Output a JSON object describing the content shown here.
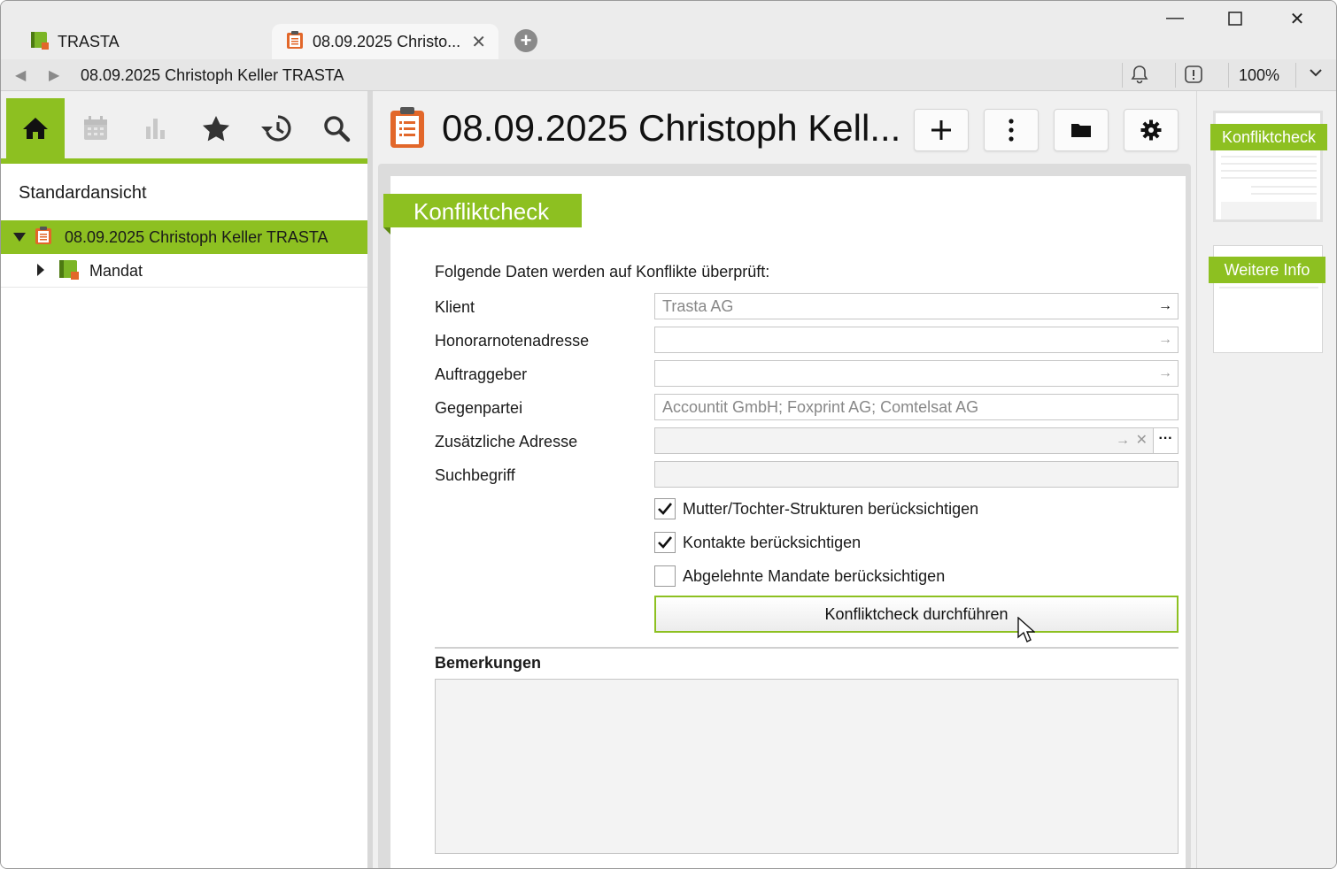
{
  "tabs": [
    {
      "label": "TRASTA",
      "icon": "book-icon"
    },
    {
      "label": "08.09.2025 Christo...",
      "icon": "clipboard-icon",
      "active": true
    }
  ],
  "address": {
    "text": "08.09.2025 Christoph Keller TRASTA",
    "zoom": "100%"
  },
  "left": {
    "view_label": "Standardansicht",
    "tree": [
      {
        "label": "08.09.2025 Christoph Keller TRASTA",
        "selected": true
      },
      {
        "label": "Mandat"
      }
    ]
  },
  "header": {
    "title": "08.09.2025 Christoph Kell..."
  },
  "section": {
    "title": "Konfliktcheck",
    "intro": "Folgende Daten werden auf Konflikte überprüft:"
  },
  "fields": [
    {
      "label": "Klient",
      "value": "Trasta AG"
    },
    {
      "label": "Honorarnotenadresse",
      "value": ""
    },
    {
      "label": "Auftraggeber",
      "value": ""
    },
    {
      "label": "Gegenpartei",
      "value": "Accountit GmbH; Foxprint AG; Comtelsat AG"
    },
    {
      "label": "Zusätzliche Adresse",
      "value": ""
    },
    {
      "label": "Suchbegriff",
      "value": ""
    }
  ],
  "checkboxes": [
    {
      "label": "Mutter/Tochter-Strukturen berücksichtigen",
      "checked": true
    },
    {
      "label": "Kontakte berücksichtigen",
      "checked": true
    },
    {
      "label": "Abgelehnte Mandate berücksichtigen",
      "checked": false
    }
  ],
  "action_button": "Konfliktcheck durchführen",
  "remarks": {
    "label": "Bemerkungen",
    "value": ""
  },
  "navigator": [
    {
      "label": "Konfliktcheck",
      "active": true
    },
    {
      "label": "Weitere Info",
      "active": false
    }
  ],
  "colors": {
    "accent": "#8dc021",
    "clipboard": "#e2672a"
  }
}
